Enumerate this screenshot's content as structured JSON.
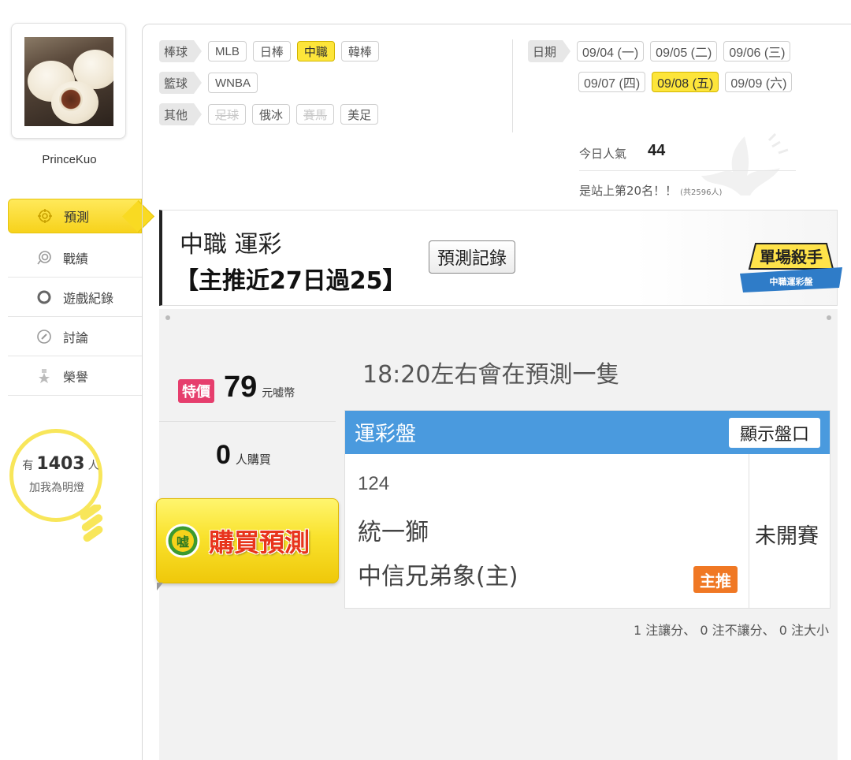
{
  "profile": {
    "username": "PrinceKuo"
  },
  "sidebar": {
    "items": [
      {
        "label": "預測",
        "icon": "target-icon",
        "active": true
      },
      {
        "label": "戰績",
        "icon": "swirl-icon",
        "active": false
      },
      {
        "label": "遊戲紀錄",
        "icon": "circle-icon",
        "active": false
      },
      {
        "label": "討論",
        "icon": "pen-icon",
        "active": false
      },
      {
        "label": "榮譽",
        "icon": "medal-icon",
        "active": false
      }
    ],
    "followers": {
      "prefix": "有",
      "count": "1403",
      "suffix": "人",
      "caption": "加我為明燈"
    }
  },
  "filters": {
    "baseball": {
      "label": "棒球",
      "options": [
        "MLB",
        "日棒",
        "中職",
        "韓棒"
      ]
    },
    "basketball": {
      "label": "籃球",
      "options": [
        "WNBA"
      ]
    },
    "other": {
      "label": "其他",
      "options": [
        "足球",
        "俄冰",
        "賽馬",
        "美足"
      ]
    },
    "date": {
      "label": "日期",
      "options": [
        "09/04 (一)",
        "09/05 (二)",
        "09/06 (三)",
        "09/07 (四)",
        "09/08 (五)",
        "09/09 (六)"
      ]
    }
  },
  "popularity": {
    "label": "今日人氣",
    "value": "44",
    "rank_text": "是站上第20名！！",
    "rank_total": "(共2596人)"
  },
  "title_panel": {
    "line1": "中職 運彩",
    "line2": "【主推近27日過25】",
    "history_button": "預測記錄",
    "badge_top": "單場殺手",
    "badge_bottom": "中職運彩盤"
  },
  "purchase": {
    "special_label": "特價",
    "price": "79",
    "price_unit": "元嘘幣",
    "buyers_count": "0",
    "buyers_unit": "人購買",
    "buy_button": "購買預測",
    "buy_icon_text": "嘘"
  },
  "note": "18:20左右會在預測一隻",
  "odds": {
    "title": "運彩盤",
    "show_button": "顯示盤口",
    "game_number": "124",
    "away_team": "統一獅",
    "home_team": "中信兄弟象(主)",
    "pick_label": "主推",
    "status": "未開賽"
  },
  "summary": "1 注讓分、 0 注不讓分、 0 注大小",
  "colors": {
    "accent_yellow": "#f9da22",
    "header_blue": "#4a9ade",
    "special_pink": "#e63e6d",
    "pick_orange": "#f07824",
    "buy_text_red": "#e8341c"
  }
}
